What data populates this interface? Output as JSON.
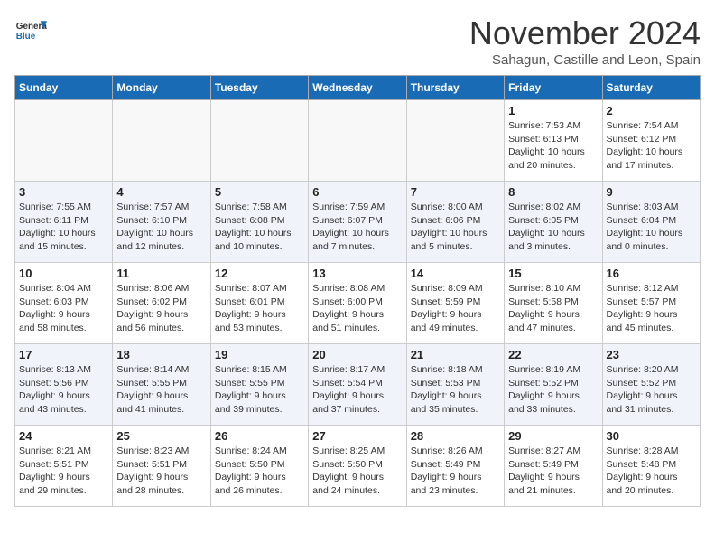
{
  "header": {
    "logo_general": "General",
    "logo_blue": "Blue",
    "month_title": "November 2024",
    "location": "Sahagun, Castille and Leon, Spain"
  },
  "weekdays": [
    "Sunday",
    "Monday",
    "Tuesday",
    "Wednesday",
    "Thursday",
    "Friday",
    "Saturday"
  ],
  "weeks": [
    [
      {
        "day": "",
        "info": ""
      },
      {
        "day": "",
        "info": ""
      },
      {
        "day": "",
        "info": ""
      },
      {
        "day": "",
        "info": ""
      },
      {
        "day": "",
        "info": ""
      },
      {
        "day": "1",
        "info": "Sunrise: 7:53 AM\nSunset: 6:13 PM\nDaylight: 10 hours\nand 20 minutes."
      },
      {
        "day": "2",
        "info": "Sunrise: 7:54 AM\nSunset: 6:12 PM\nDaylight: 10 hours\nand 17 minutes."
      }
    ],
    [
      {
        "day": "3",
        "info": "Sunrise: 7:55 AM\nSunset: 6:11 PM\nDaylight: 10 hours\nand 15 minutes."
      },
      {
        "day": "4",
        "info": "Sunrise: 7:57 AM\nSunset: 6:10 PM\nDaylight: 10 hours\nand 12 minutes."
      },
      {
        "day": "5",
        "info": "Sunrise: 7:58 AM\nSunset: 6:08 PM\nDaylight: 10 hours\nand 10 minutes."
      },
      {
        "day": "6",
        "info": "Sunrise: 7:59 AM\nSunset: 6:07 PM\nDaylight: 10 hours\nand 7 minutes."
      },
      {
        "day": "7",
        "info": "Sunrise: 8:00 AM\nSunset: 6:06 PM\nDaylight: 10 hours\nand 5 minutes."
      },
      {
        "day": "8",
        "info": "Sunrise: 8:02 AM\nSunset: 6:05 PM\nDaylight: 10 hours\nand 3 minutes."
      },
      {
        "day": "9",
        "info": "Sunrise: 8:03 AM\nSunset: 6:04 PM\nDaylight: 10 hours\nand 0 minutes."
      }
    ],
    [
      {
        "day": "10",
        "info": "Sunrise: 8:04 AM\nSunset: 6:03 PM\nDaylight: 9 hours\nand 58 minutes."
      },
      {
        "day": "11",
        "info": "Sunrise: 8:06 AM\nSunset: 6:02 PM\nDaylight: 9 hours\nand 56 minutes."
      },
      {
        "day": "12",
        "info": "Sunrise: 8:07 AM\nSunset: 6:01 PM\nDaylight: 9 hours\nand 53 minutes."
      },
      {
        "day": "13",
        "info": "Sunrise: 8:08 AM\nSunset: 6:00 PM\nDaylight: 9 hours\nand 51 minutes."
      },
      {
        "day": "14",
        "info": "Sunrise: 8:09 AM\nSunset: 5:59 PM\nDaylight: 9 hours\nand 49 minutes."
      },
      {
        "day": "15",
        "info": "Sunrise: 8:10 AM\nSunset: 5:58 PM\nDaylight: 9 hours\nand 47 minutes."
      },
      {
        "day": "16",
        "info": "Sunrise: 8:12 AM\nSunset: 5:57 PM\nDaylight: 9 hours\nand 45 minutes."
      }
    ],
    [
      {
        "day": "17",
        "info": "Sunrise: 8:13 AM\nSunset: 5:56 PM\nDaylight: 9 hours\nand 43 minutes."
      },
      {
        "day": "18",
        "info": "Sunrise: 8:14 AM\nSunset: 5:55 PM\nDaylight: 9 hours\nand 41 minutes."
      },
      {
        "day": "19",
        "info": "Sunrise: 8:15 AM\nSunset: 5:55 PM\nDaylight: 9 hours\nand 39 minutes."
      },
      {
        "day": "20",
        "info": "Sunrise: 8:17 AM\nSunset: 5:54 PM\nDaylight: 9 hours\nand 37 minutes."
      },
      {
        "day": "21",
        "info": "Sunrise: 8:18 AM\nSunset: 5:53 PM\nDaylight: 9 hours\nand 35 minutes."
      },
      {
        "day": "22",
        "info": "Sunrise: 8:19 AM\nSunset: 5:52 PM\nDaylight: 9 hours\nand 33 minutes."
      },
      {
        "day": "23",
        "info": "Sunrise: 8:20 AM\nSunset: 5:52 PM\nDaylight: 9 hours\nand 31 minutes."
      }
    ],
    [
      {
        "day": "24",
        "info": "Sunrise: 8:21 AM\nSunset: 5:51 PM\nDaylight: 9 hours\nand 29 minutes."
      },
      {
        "day": "25",
        "info": "Sunrise: 8:23 AM\nSunset: 5:51 PM\nDaylight: 9 hours\nand 28 minutes."
      },
      {
        "day": "26",
        "info": "Sunrise: 8:24 AM\nSunset: 5:50 PM\nDaylight: 9 hours\nand 26 minutes."
      },
      {
        "day": "27",
        "info": "Sunrise: 8:25 AM\nSunset: 5:50 PM\nDaylight: 9 hours\nand 24 minutes."
      },
      {
        "day": "28",
        "info": "Sunrise: 8:26 AM\nSunset: 5:49 PM\nDaylight: 9 hours\nand 23 minutes."
      },
      {
        "day": "29",
        "info": "Sunrise: 8:27 AM\nSunset: 5:49 PM\nDaylight: 9 hours\nand 21 minutes."
      },
      {
        "day": "30",
        "info": "Sunrise: 8:28 AM\nSunset: 5:48 PM\nDaylight: 9 hours\nand 20 minutes."
      }
    ]
  ]
}
